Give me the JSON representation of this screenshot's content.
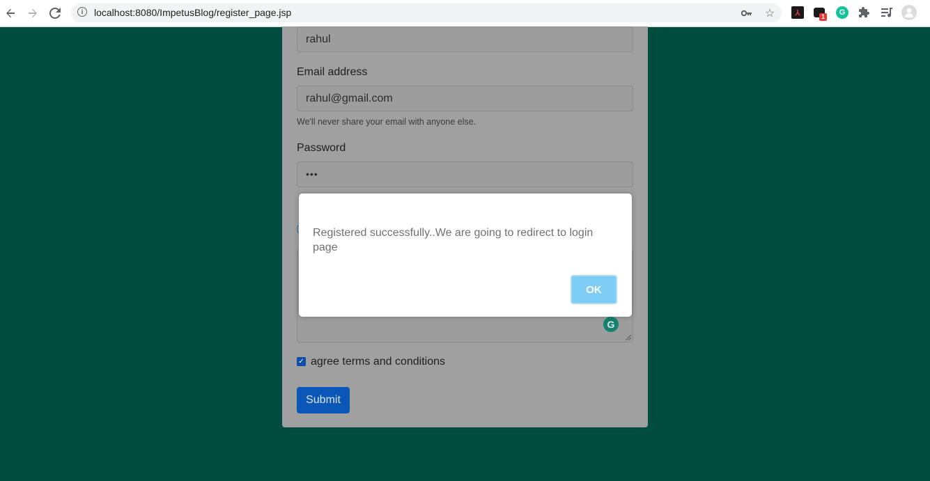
{
  "browser": {
    "url": "localhost:8080/ImpetusBlog/register_page.jsp",
    "extension_badge": "1"
  },
  "form": {
    "name_value": "rahul",
    "email_label": "Email address",
    "email_value": "rahul@gmail.com",
    "email_help": "We'll never share your email with anyone else.",
    "password_label": "Password",
    "password_value": "•••",
    "terms_label": "agree terms and conditions",
    "terms_checked": "✓",
    "submit_label": "Submit"
  },
  "dialog": {
    "message": "Registered successfully..We are going to redirect to login page",
    "ok_label": "OK"
  },
  "colors": {
    "page_background": "#004d40",
    "submit_button": "#0a57b8",
    "ok_button": "#7ecdf4"
  }
}
